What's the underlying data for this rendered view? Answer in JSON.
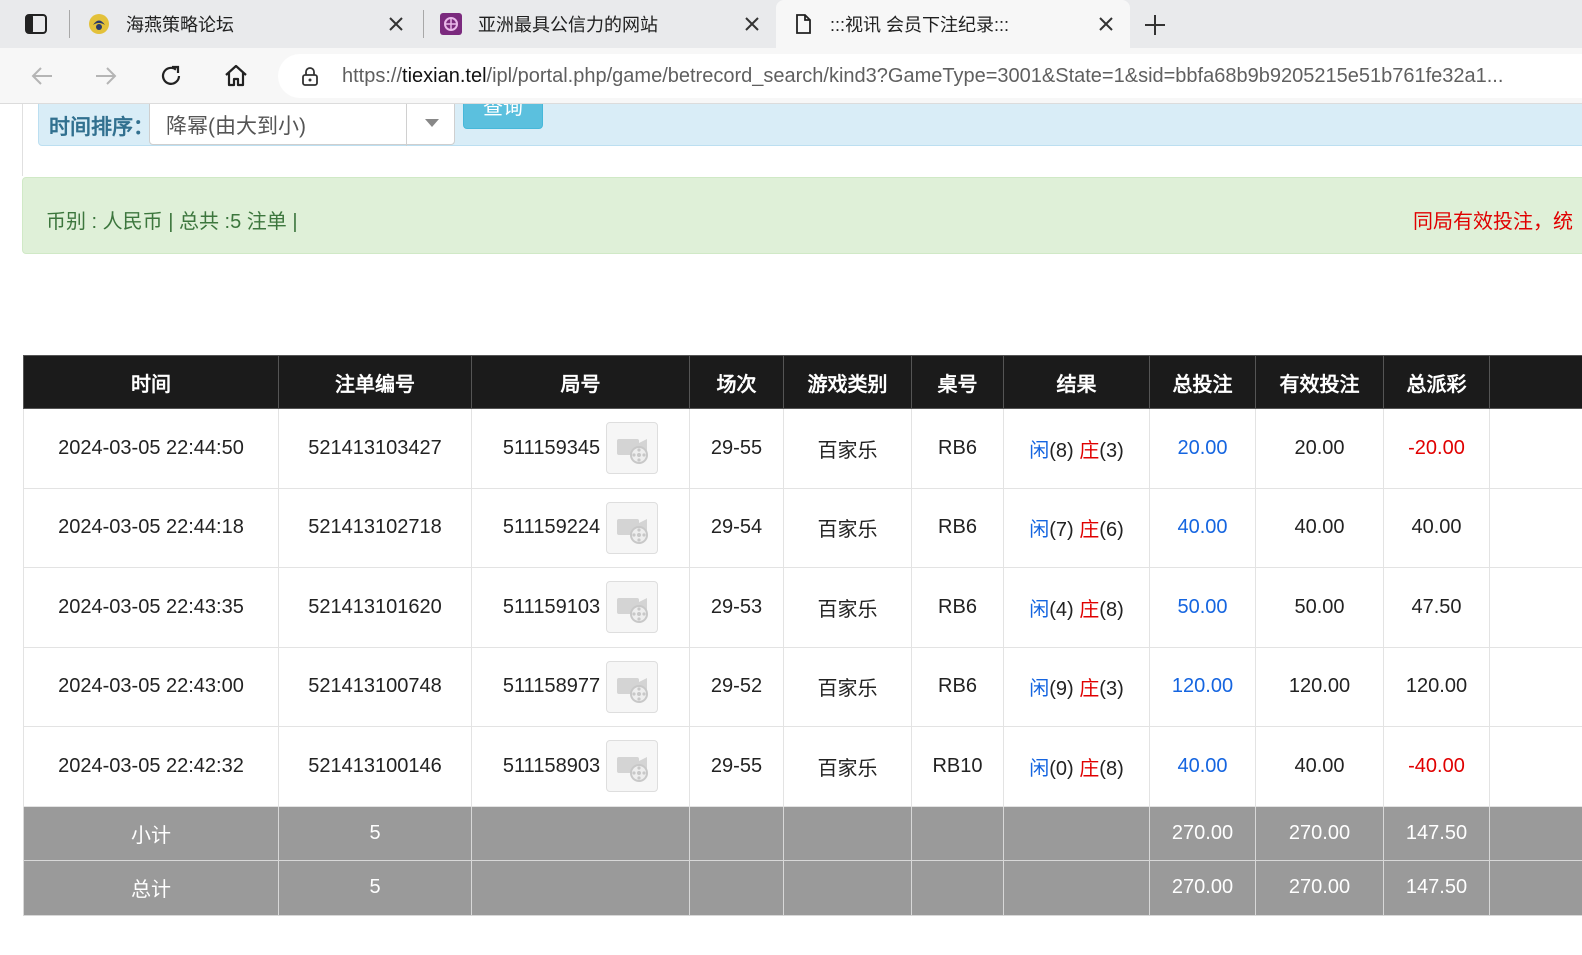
{
  "browser": {
    "tabs": [
      {
        "title": "海燕策略论坛",
        "active": false
      },
      {
        "title": "亚洲最具公信力的网站",
        "active": false
      },
      {
        "title": ":::视讯 会员下注纪录:::",
        "active": true
      }
    ],
    "url_prefix": "https://",
    "url_host": "tiexian.tel",
    "url_path": "/ipl/portal.php/game/betrecord_search/kind3?GameType=3001&State=1&sid=bbfa68b9b9205215e51b761fe32a1..."
  },
  "search": {
    "sort_label": "时间排序：",
    "sort_value": "降幂(由大到小)",
    "query_button": "查询"
  },
  "info": {
    "summary": "币别 : 人民币 | 总共 :5 注单 |",
    "notice": "同局有效投注，统"
  },
  "table": {
    "headers": [
      "时间",
      "注单编号",
      "局号",
      "场次",
      "游戏类别",
      "桌号",
      "结果",
      "总投注",
      "有效投注",
      "总派彩",
      ""
    ],
    "result_player": "闲",
    "result_banker": "庄",
    "rows": [
      {
        "time": "2024-03-05 22:44:50",
        "bet_id": "521413103427",
        "round": "511159345",
        "shoe": "29-55",
        "game": "百家乐",
        "table": "RB6",
        "player": "(8)",
        "banker": "(3)",
        "total_bet": "20.00",
        "valid_bet": "20.00",
        "payout": "-20.00",
        "payout_negative": true
      },
      {
        "time": "2024-03-05 22:44:18",
        "bet_id": "521413102718",
        "round": "511159224",
        "shoe": "29-54",
        "game": "百家乐",
        "table": "RB6",
        "player": "(7)",
        "banker": "(6)",
        "total_bet": "40.00",
        "valid_bet": "40.00",
        "payout": "40.00",
        "payout_negative": false
      },
      {
        "time": "2024-03-05 22:43:35",
        "bet_id": "521413101620",
        "round": "511159103",
        "shoe": "29-53",
        "game": "百家乐",
        "table": "RB6",
        "player": "(4)",
        "banker": "(8)",
        "total_bet": "50.00",
        "valid_bet": "50.00",
        "payout": "47.50",
        "payout_negative": false
      },
      {
        "time": "2024-03-05 22:43:00",
        "bet_id": "521413100748",
        "round": "511158977",
        "shoe": "29-52",
        "game": "百家乐",
        "table": "RB6",
        "player": "(9)",
        "banker": "(3)",
        "total_bet": "120.00",
        "valid_bet": "120.00",
        "payout": "120.00",
        "payout_negative": false
      },
      {
        "time": "2024-03-05 22:42:32",
        "bet_id": "521413100146",
        "round": "511158903",
        "shoe": "29-55",
        "game": "百家乐",
        "table": "RB10",
        "player": "(0)",
        "banker": "(8)",
        "total_bet": "40.00",
        "valid_bet": "40.00",
        "payout": "-40.00",
        "payout_negative": true
      }
    ],
    "subtotal": {
      "label": "小计",
      "count": "5",
      "total_bet": "270.00",
      "valid_bet": "270.00",
      "payout": "147.50"
    },
    "grand_total": {
      "label": "总计",
      "count": "5",
      "total_bet": "270.00",
      "valid_bet": "270.00",
      "payout": "147.50"
    }
  },
  "colors": {
    "player": "#1565e0",
    "banker": "#e00000",
    "header_bg": "#1b1b1b",
    "footer_bg": "#9a9a9a"
  }
}
